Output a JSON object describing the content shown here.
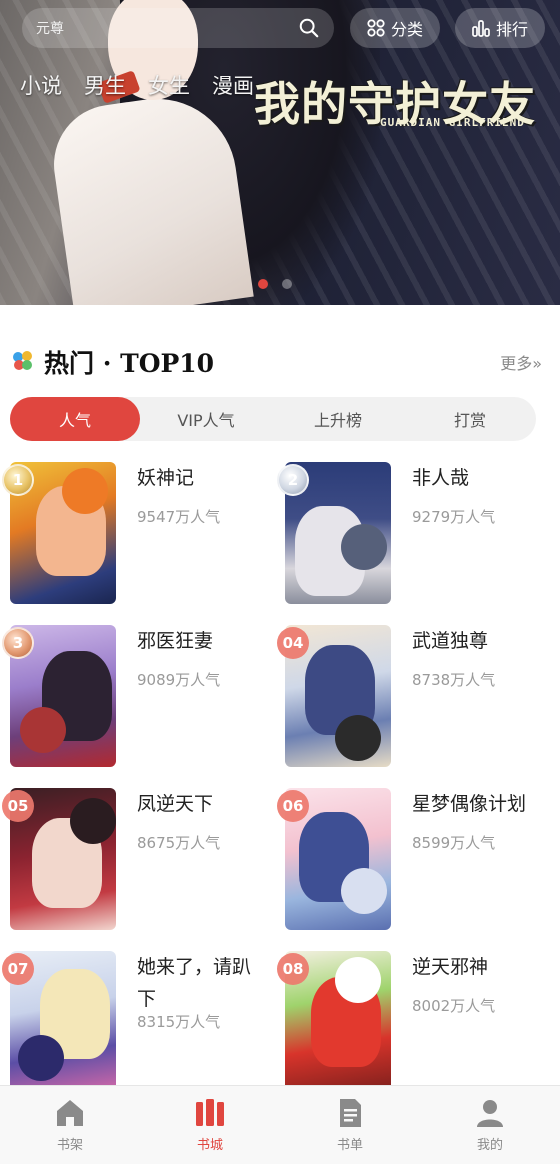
{
  "banner": {
    "search_brand": "元尊",
    "category_label": "分类",
    "rank_label": "排行",
    "nav_tabs": [
      "小说",
      "男生",
      "女生",
      "漫画"
    ],
    "title_art": "我的守护女友",
    "title_sub": "GUARDIAN GIRLFRIEND",
    "slide_count": 2,
    "active_slide": 0
  },
  "section": {
    "title": "热门 · TOP10",
    "more_label": "更多»"
  },
  "rank_tabs": [
    "人气",
    "VIP人气",
    "上升榜",
    "打赏"
  ],
  "active_rank_tab": 0,
  "books": [
    {
      "rank": "1",
      "title": "妖神记",
      "popularity": "9547万人气"
    },
    {
      "rank": "2",
      "title": "非人哉",
      "popularity": "9279万人气"
    },
    {
      "rank": "3",
      "title": "邪医狂妻",
      "popularity": "9089万人气"
    },
    {
      "rank": "04",
      "title": "武道独尊",
      "popularity": "8738万人气"
    },
    {
      "rank": "05",
      "title": "凤逆天下",
      "popularity": "8675万人气"
    },
    {
      "rank": "06",
      "title": "星梦偶像计划",
      "popularity": "8599万人气"
    },
    {
      "rank": "07",
      "title": "她来了，请趴下",
      "popularity": "8315万人气"
    },
    {
      "rank": "08",
      "title": "逆天邪神",
      "popularity": "8002万人气"
    }
  ],
  "tabbar": {
    "items": [
      "书架",
      "书城",
      "书单",
      "我的"
    ],
    "active": 1
  },
  "colors": {
    "accent": "#e0463f",
    "muted_text": "#9a9a9a",
    "tab_bg": "#f1f1f1"
  }
}
